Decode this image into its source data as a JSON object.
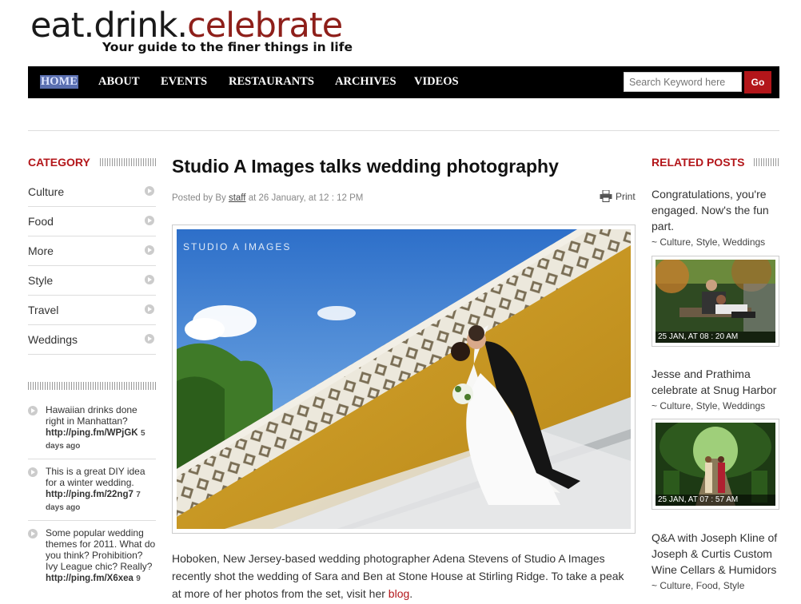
{
  "site": {
    "logo_part1": "eat.drink.",
    "logo_part2": "celebrate",
    "tagline": "Your guide to the finer things in life"
  },
  "nav": {
    "items": [
      "HOME",
      "ABOUT",
      "EVENTS",
      "RESTAURANTS",
      "ARCHIVES",
      "VIDEOS"
    ],
    "search_placeholder": "Search Keyword here",
    "search_button": "Go"
  },
  "sidebar": {
    "category_heading": "CATEGORY",
    "categories": [
      "Culture",
      "Food",
      "More",
      "Style",
      "Travel",
      "Weddings"
    ],
    "tweets": [
      {
        "text": "Hawaiian drinks done right in Manhattan?",
        "link": "http://ping.fm/WPjGK",
        "num": "5",
        "ago": "days ago"
      },
      {
        "text": "This is a great DIY idea for a winter wedding.",
        "link": "http://ping.fm/22ng7",
        "num": "7",
        "ago": "days ago"
      },
      {
        "text": "Some popular wedding themes for 2011. What do you think? Prohibition? Ivy League chic? Really?",
        "link": "http://ping.fm/X6xea",
        "num": "9",
        "ago": ""
      }
    ]
  },
  "post": {
    "title": "Studio A Images talks wedding photography",
    "meta_prefix": "Posted by By",
    "author": "staff",
    "meta_suffix": "at 26 January, at 12 : 12 PM",
    "print_label": "Print",
    "watermark": "STUDIO A IMAGES",
    "body": "Hoboken, New Jersey-based wedding photographer Adena Stevens of Studio A Images recently shot the wedding of Sara and Ben at Stone House at Stirling Ridge. To take a peak at more of her photos from the set, visit her",
    "body_link": "blog",
    "body_end": "."
  },
  "related": {
    "heading": "RELATED POSTS",
    "posts": [
      {
        "title": "Congratulations, you're engaged. Now's the fun part.",
        "cats": "~ Culture, Style, Weddings",
        "date": "25 JAN, AT 08 : 20 AM"
      },
      {
        "title": "Jesse and Prathima celebrate at Snug Harbor",
        "cats": "~ Culture, Style, Weddings",
        "date": "25 JAN, AT 07 : 57 AM"
      },
      {
        "title": "Q&A with Joseph Kline of Joseph & Curtis Custom Wine Cellars & Humidors",
        "cats": "~ Culture, Food, Style",
        "date": ""
      }
    ]
  },
  "colors": {
    "accent": "#b3161a",
    "logo_red": "#8e1f1a",
    "nav_bg": "#000000"
  }
}
